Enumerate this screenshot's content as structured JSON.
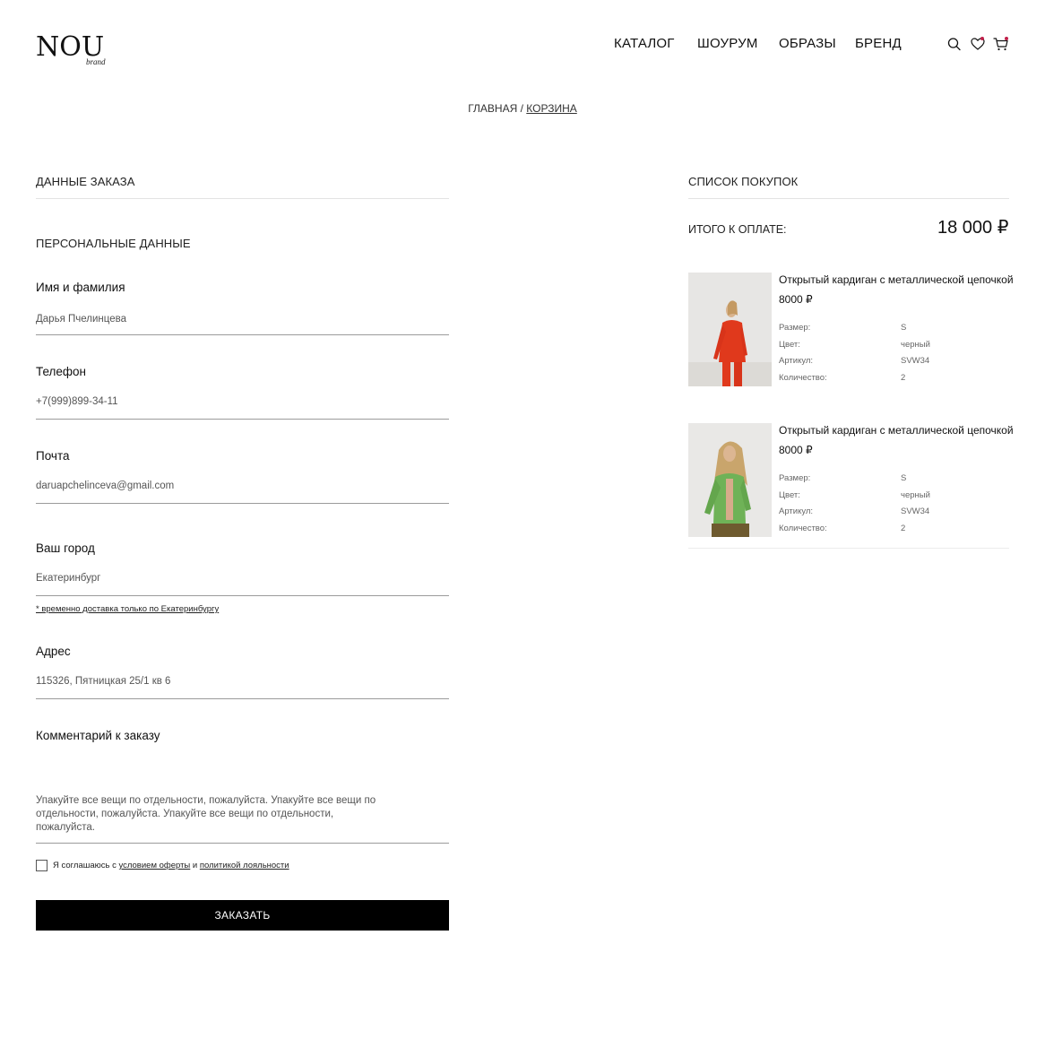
{
  "header": {
    "logo_main": "NOU",
    "logo_sub": "brand",
    "nav": [
      "КАТАЛОГ",
      "ШОУРУМ",
      "ОБРАЗЫ",
      "БРЕНД"
    ],
    "icons": [
      "search-icon",
      "heart-icon",
      "cart-icon"
    ],
    "badge_color": "#c0204a"
  },
  "breadcrumb": {
    "home": "ГЛАВНАЯ",
    "separator": " / ",
    "current": "КОРЗИНА"
  },
  "order": {
    "title": "ДАННЫЕ ЗАКАЗА",
    "personal_title": "ПЕРСОНАЛЬНЫЕ ДАННЫЕ",
    "name_label": "Имя и фамилия",
    "name_value": "Дарья Пчелинцева",
    "phone_label": "Телефон",
    "phone_value": "+7(999)899-34-11",
    "email_label": "Почта",
    "email_value": "daruapchelinceva@gmail.com",
    "city_label": "Ваш город",
    "city_value": "Екатеринбург",
    "city_note": "* временно доставка только по Екатеринбургу",
    "address_label": "Адрес",
    "address_value": "115326, Пятницкая 25/1 кв 6",
    "comment_label": "Комментарий к заказу",
    "comment_value": "Упакуйте все вещи по отдельности, пожалуйста. Упакуйте все вещи по отдельности, пожалуйста. Упакуйте все вещи по отдельности, пожалуйста.",
    "agree_prefix": "Я соглашаюсь с ",
    "agree_link1": "условием оферты",
    "agree_mid": " и ",
    "agree_link2": "политикой лояльности",
    "agree_checked": false,
    "submit_label": "ЗАКАЗАТЬ"
  },
  "cart": {
    "title": "СПИСОК ПОКУПОК",
    "total_label": "ИТОГО К ОПЛАТЕ:",
    "total_value": "18 000 ₽",
    "spec_keys": {
      "size": "Размер:",
      "color": "Цвет:",
      "sku": "Артикул:",
      "qty": "Количество:"
    },
    "items": [
      {
        "name": "Открытый кардиган с металлической цепочкой",
        "price": "8000 ₽",
        "size": "S",
        "color": "черный",
        "sku": "SVW34",
        "qty": "2",
        "garment_color": "#e0391c"
      },
      {
        "name": "Открытый кардиган с металлической цепочкой",
        "price": "8000 ₽",
        "size": "S",
        "color": "черный",
        "sku": "SVW34",
        "qty": "2",
        "garment_color": "#6fb257"
      }
    ]
  }
}
